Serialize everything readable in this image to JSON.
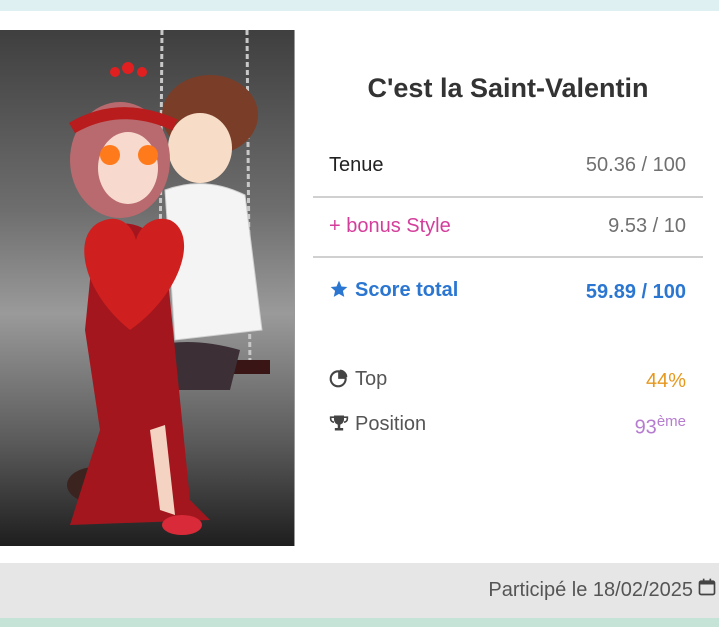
{
  "card": {
    "title": "C'est la Saint-Valentin"
  },
  "scores": {
    "outfit_label": "Tenue",
    "outfit_value": "50.36 / 100",
    "bonus_label": "+ bonus Style",
    "bonus_value": "9.53 / 10",
    "total_label": "Score total",
    "total_value": "59.89 / 100"
  },
  "ranking": {
    "top_label": "Top",
    "top_value": "44%",
    "position_label": "Position",
    "position_number": "93",
    "position_suffix": "ème"
  },
  "footer": {
    "participated_text": "Participé le 18/02/2025"
  },
  "icons": {
    "total": "star-icon",
    "top": "pie-chart-icon",
    "position": "trophy-icon",
    "date": "calendar-icon"
  },
  "colors": {
    "pink": "#d43e9b",
    "blue": "#2b76d1",
    "orange": "#e6981e",
    "purple": "#b67ccf"
  }
}
